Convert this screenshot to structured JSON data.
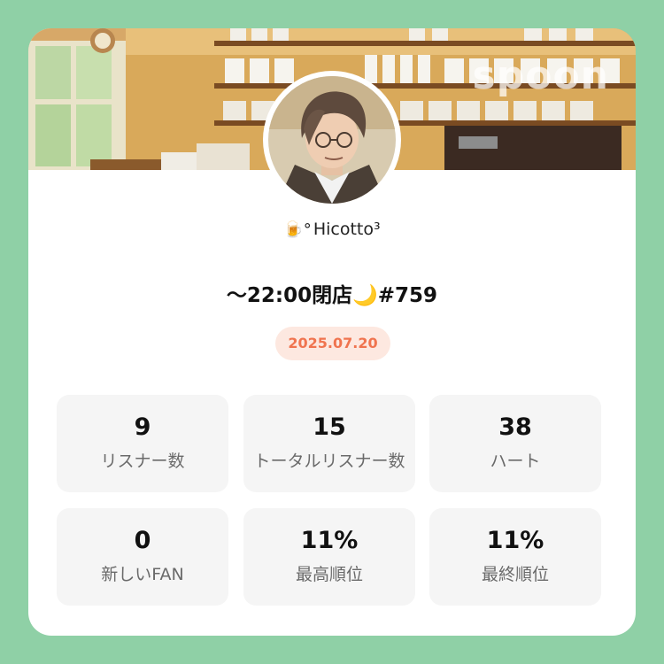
{
  "brand": {
    "logo_text": "spoon"
  },
  "profile": {
    "username": "Hicotto³",
    "username_icon": "beer-mug-icon"
  },
  "broadcast": {
    "title": "～22:00閉店🌙#759",
    "date": "2025.07.20"
  },
  "stats": [
    {
      "value": "9",
      "label": "リスナー数"
    },
    {
      "value": "15",
      "label": "トータルリスナー数"
    },
    {
      "value": "38",
      "label": "ハート"
    },
    {
      "value": "0",
      "label": "新しいFAN"
    },
    {
      "value": "11%",
      "label": "最高順位"
    },
    {
      "value": "11%",
      "label": "最終順位"
    }
  ],
  "colors": {
    "background": "#8fd0a6",
    "card": "#ffffff",
    "badge_bg": "#fde8e0",
    "badge_text": "#f0744f",
    "stat_bg": "#f5f5f5"
  }
}
